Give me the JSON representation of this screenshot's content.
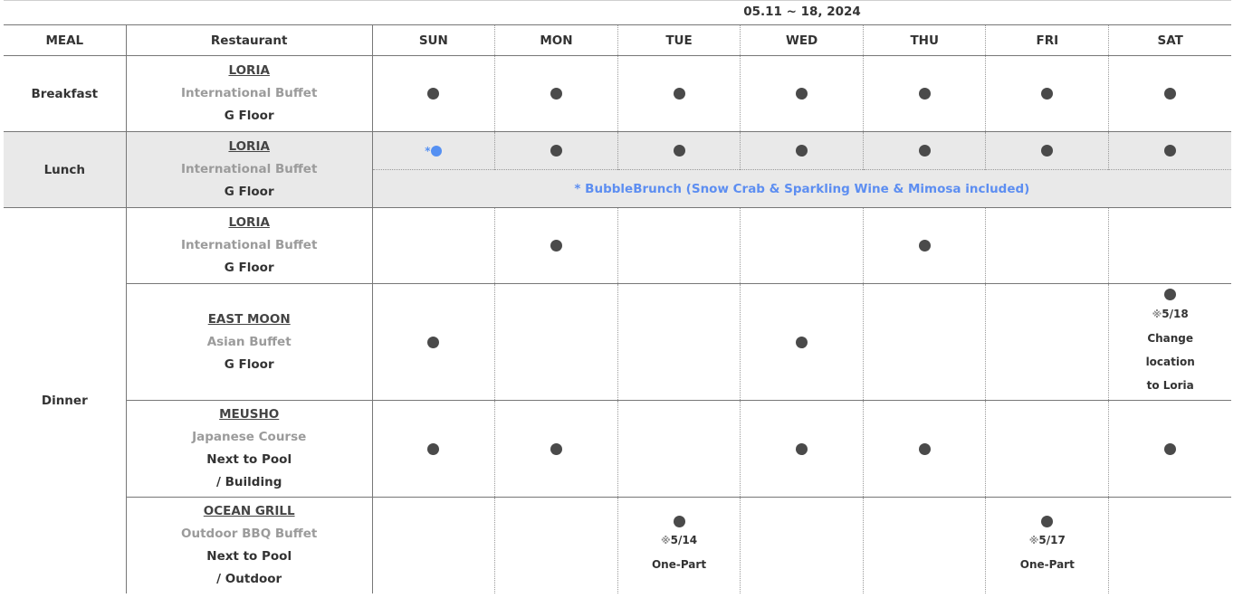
{
  "period": "05.11 ~ 18, 2024",
  "headers": {
    "meal": "MEAL",
    "restaurant": "Restaurant",
    "days": [
      "SUN",
      "MON",
      "TUE",
      "WED",
      "THU",
      "FRI",
      "SAT"
    ]
  },
  "meals": {
    "breakfast": "Breakfast",
    "lunch": "Lunch",
    "dinner": "Dinner"
  },
  "breakfast": {
    "name": "LORIA",
    "type": "International Buffet",
    "location": "G Floor"
  },
  "lunch": {
    "name": "LORIA",
    "type": "International Buffet",
    "location": "G Floor",
    "star": "*",
    "bubble_note": "* BubbleBrunch (Snow Crab & Sparkling Wine & Mimosa included)"
  },
  "dinner": [
    {
      "name": "LORIA",
      "type": "International Buffet",
      "location": "G Floor"
    },
    {
      "name": "EAST MOON",
      "type": "Asian Buffet",
      "location": "G Floor",
      "sat_note": {
        "mark": "※",
        "date": "5/18",
        "line1": "Change",
        "line2": "location",
        "line3": "to Loria"
      }
    },
    {
      "name": "MEUSHO",
      "type": "Japanese Course",
      "location1": "Next to Pool",
      "location2": "/ Building"
    },
    {
      "name": "OCEAN GRILL",
      "type": "Outdoor BBQ Buffet",
      "location1": "Next to Pool",
      "location2": "/ Outdoor",
      "tue_note": {
        "mark": "※",
        "date": "5/14",
        "text": "One-Part"
      },
      "fri_note": {
        "mark": "※",
        "date": "5/17",
        "text": "One-Part"
      }
    }
  ],
  "colors": {
    "dot": "#4a4a4a",
    "highlight_blue": "#5590f2",
    "lunch_band": "#e9e9e9"
  }
}
